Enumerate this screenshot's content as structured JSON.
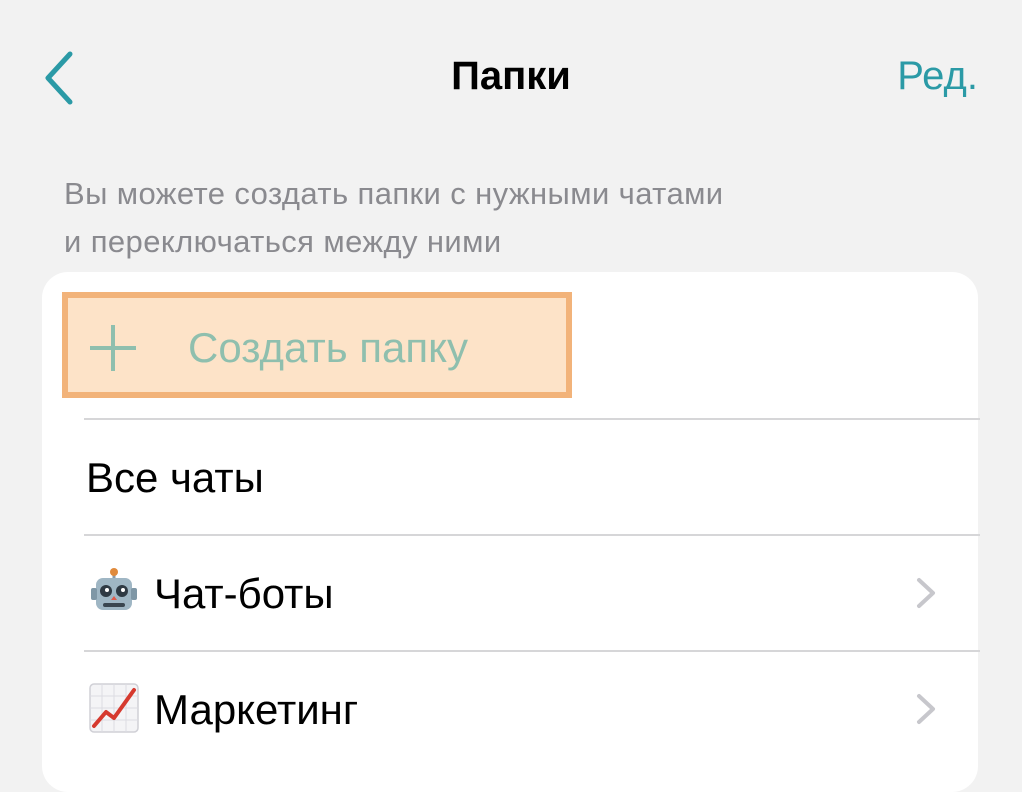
{
  "nav": {
    "title": "Папки",
    "edit_label": "Ред.",
    "back_icon": "chevron-left-icon"
  },
  "description": {
    "line1": "Вы можете создать папки с нужными чатами",
    "line2": "и переключаться между ними"
  },
  "list": {
    "create_label": "Создать папку",
    "create_icon": "plus-icon",
    "items": [
      {
        "label": "Все чаты"
      },
      {
        "label": "Чат-боты",
        "icon": "robot-emoji-icon",
        "chevron": "chevron-right-icon"
      },
      {
        "label": "Маркетинг",
        "icon": "chart-increasing-emoji-icon",
        "chevron": "chevron-right-icon"
      }
    ]
  },
  "colors": {
    "accent": "#2b9aa6",
    "highlight_fill": "#fde3c8",
    "highlight_border": "#f2b37a",
    "create_text": "#8fbfae",
    "background": "#f2f2f2"
  }
}
